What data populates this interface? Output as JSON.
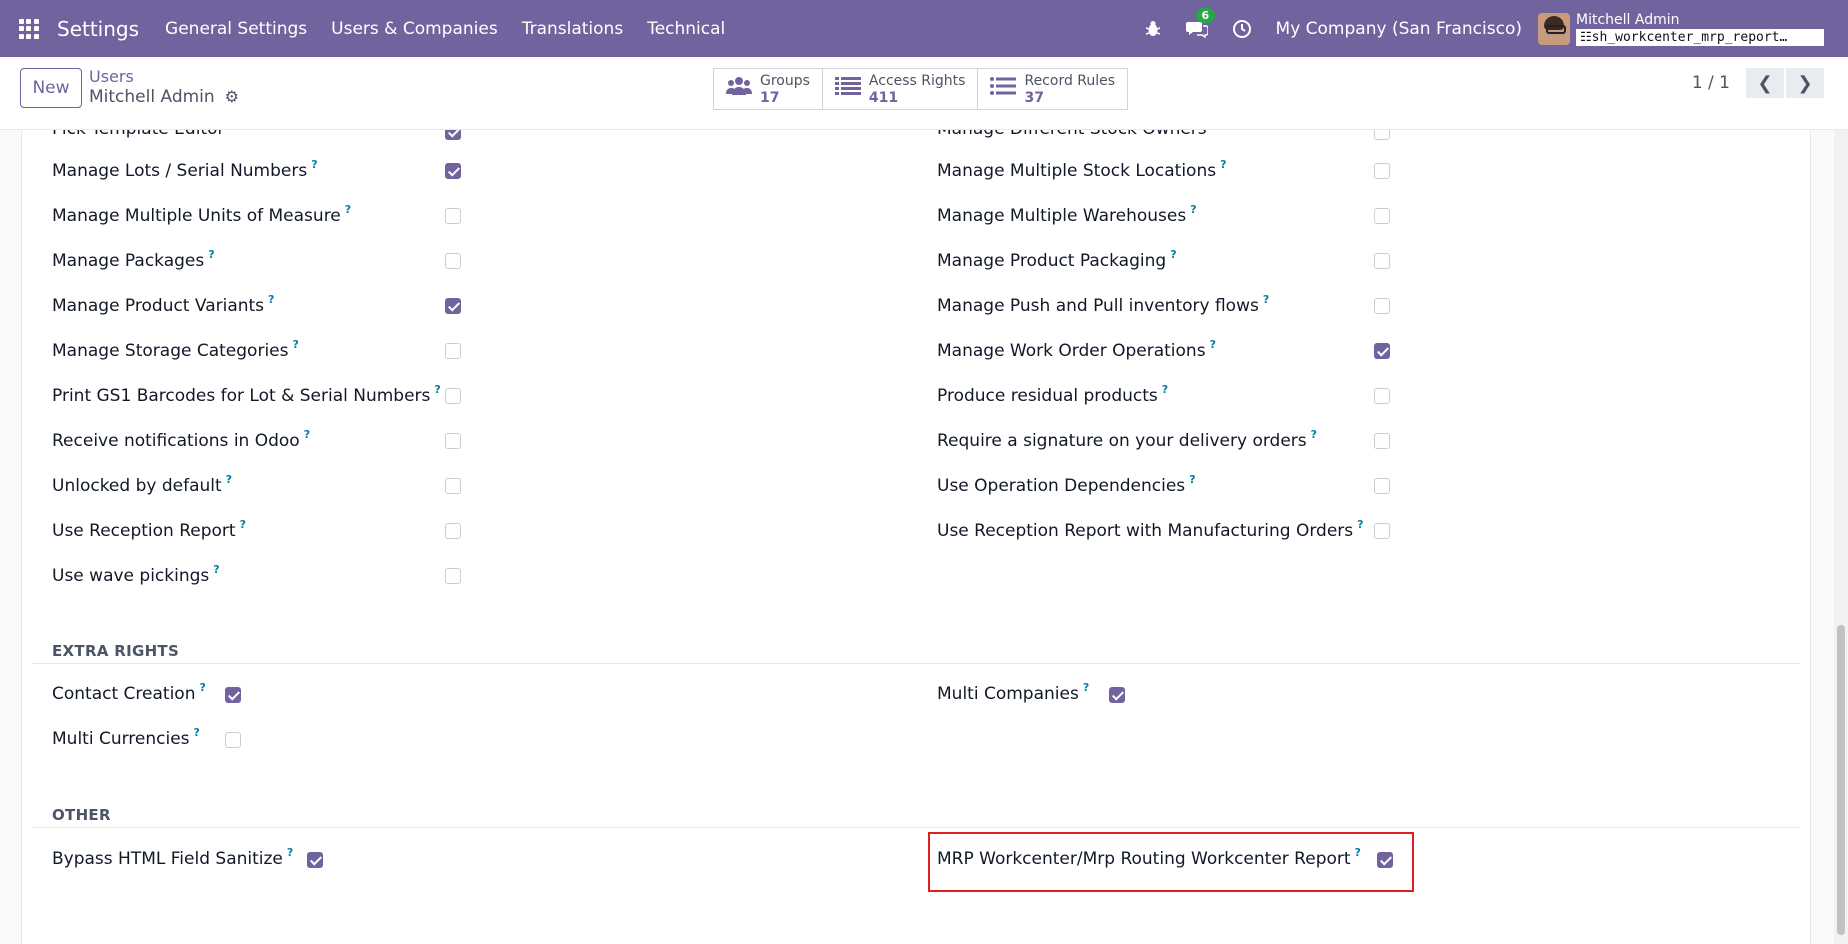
{
  "navbar": {
    "app_name": "Settings",
    "menu": [
      "General Settings",
      "Users & Companies",
      "Translations",
      "Technical"
    ],
    "message_count": "6",
    "company": "My Company (San Francisco)",
    "user_name": "Mitchell Admin",
    "database": "sh_workcenter_mrp_report…",
    "accent_color": "#71639e"
  },
  "control_panel": {
    "new_label": "New",
    "breadcrumb_parent": "Users",
    "breadcrumb_current": "Mitchell Admin",
    "smart_buttons": [
      {
        "label": "Groups",
        "value": "17",
        "icon": "users-icon"
      },
      {
        "label": "Access Rights",
        "value": "411",
        "icon": "list-icon"
      },
      {
        "label": "Record Rules",
        "value": "37",
        "icon": "list-icon"
      }
    ],
    "pager": "1 / 1"
  },
  "partial_top": {
    "left_label": "Pick Template Editor",
    "right_label": "Manage Different Stock Owners"
  },
  "technical_left": [
    {
      "label": "Manage Lots / Serial Numbers",
      "checked": true
    },
    {
      "label": "Manage Multiple Units of Measure",
      "checked": false
    },
    {
      "label": "Manage Packages",
      "checked": false
    },
    {
      "label": "Manage Product Variants",
      "checked": true
    },
    {
      "label": "Manage Storage Categories",
      "checked": false
    },
    {
      "label": "Print GS1 Barcodes for Lot & Serial Numbers",
      "checked": false
    },
    {
      "label": "Receive notifications in Odoo",
      "checked": false
    },
    {
      "label": "Unlocked by default",
      "checked": false
    },
    {
      "label": "Use Reception Report",
      "checked": false
    },
    {
      "label": "Use wave pickings",
      "checked": false
    }
  ],
  "technical_right": [
    {
      "label": "Manage Multiple Stock Locations",
      "checked": false
    },
    {
      "label": "Manage Multiple Warehouses",
      "checked": false
    },
    {
      "label": "Manage Product Packaging",
      "checked": false
    },
    {
      "label": "Manage Push and Pull inventory flows",
      "checked": false
    },
    {
      "label": "Manage Work Order Operations",
      "checked": true
    },
    {
      "label": "Produce residual products",
      "checked": false
    },
    {
      "label": "Require a signature on your delivery orders",
      "checked": false
    },
    {
      "label": "Use Operation Dependencies",
      "checked": false
    },
    {
      "label": "Use Reception Report with Manufacturing Orders",
      "checked": false
    }
  ],
  "extra_rights": {
    "title": "EXTRA RIGHTS",
    "items": [
      {
        "label": "Contact Creation",
        "checked": true
      },
      {
        "label": "Multi Companies",
        "checked": true
      },
      {
        "label": "Multi Currencies",
        "checked": false
      }
    ]
  },
  "other": {
    "title": "OTHER",
    "items": [
      {
        "label": "Bypass HTML Field Sanitize",
        "checked": true
      },
      {
        "label": "MRP Workcenter/Mrp Routing Workcenter Report",
        "checked": true
      }
    ]
  },
  "help_marker": "?"
}
